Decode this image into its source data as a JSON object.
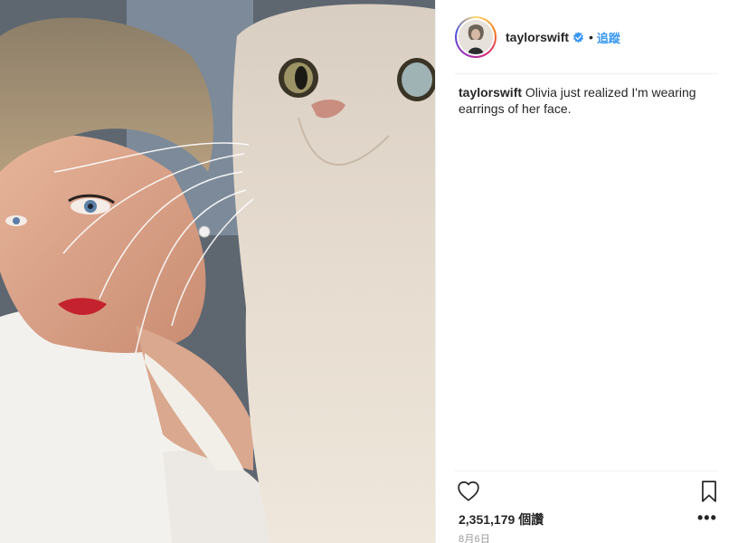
{
  "post": {
    "image_alt": "",
    "header": {
      "username": "taylorswift",
      "verified_icon": "verified-badge-icon",
      "separator": "•",
      "follow_label": "追蹤"
    },
    "caption": {
      "username": "taylorswift",
      "text": "Olivia just realized I'm wearing earrings of her face."
    },
    "actions": {
      "like_icon": "heart-icon",
      "save_icon": "bookmark-icon",
      "more_icon": "more-options-icon",
      "more_label": "•••"
    },
    "likes": {
      "count": "2,351,179",
      "unit": "個讚"
    },
    "date": "8月6日"
  },
  "colors": {
    "link_blue": "#3897f0",
    "verified_blue": "#3897f0",
    "text": "#262626",
    "muted": "#999999",
    "divider": "#efefef"
  }
}
